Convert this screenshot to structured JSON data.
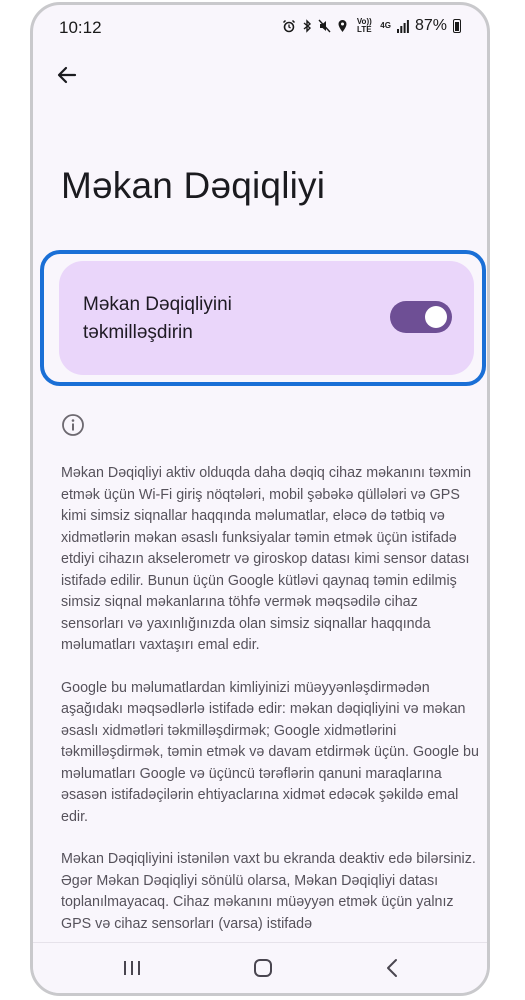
{
  "status_bar": {
    "time": "10:12",
    "network_label": "4G",
    "volte_label": "Vo)) LTE",
    "battery": "87%",
    "icons": [
      "alarm-icon",
      "bluetooth-icon",
      "mute-icon",
      "location-icon",
      "volte-icon",
      "4g-icon",
      "signal-icon",
      "battery-icon"
    ]
  },
  "header": {
    "back_icon": "arrow-left-icon",
    "title": "Məkan Dəqiqliyi"
  },
  "toggle": {
    "label": "Məkan Dəqiqliyini təkmilləşdirin",
    "state": "on",
    "color_on": "#6e4f95",
    "card_color": "#ead6fa"
  },
  "highlight_color": "#1a6fd6",
  "info": {
    "icon": "info-icon",
    "paragraphs": [
      "Məkan Dəqiqliyi aktiv olduqda daha dəqiq cihaz məkanını təxmin etmək üçün Wi-Fi giriş nöqtələri, mobil şəbəkə qüllələri və GPS kimi simsiz siqnallar haqqında məlumatlar, eləcə də tətbiq və xidmətlərin məkan əsaslı funksiyalar təmin etmək üçün istifadə etdiyi cihazın akselerometr və giroskop datası kimi sensor datası istifadə edilir. Bunun üçün Google kütləvi qaynaq təmin edilmiş simsiz siqnal məkanlarına töhfə vermək məqsədilə cihaz sensorları və yaxınlığınızda olan simsiz siqnallar haqqında məlumatları vaxtaşırı emal edir.",
      "Google bu məlumatlardan kimliyinizi müəyyənləşdirmədən aşağıdakı məqsədlərlə istifadə edir: məkan dəqiqliyini və məkan əsaslı xidmətləri təkmilləşdirmək; Google xidmətlərini təkmilləşdirmək, təmin etmək və davam etdirmək üçün. Google bu məlumatları Google və üçüncü tərəflərin qanuni maraqlarına əsasən istifadəçilərin ehtiyaclarına xidmət edəcək şəkildə emal edir.",
      "Məkan Dəqiqliyini istənilən vaxt bu ekranda deaktiv edə bilərsiniz. Əgər Məkan Dəqiqliyi sönülü olarsa, Məkan Dəqiqliyi datası toplanılmayacaq. Cihaz məkanını müəyyən etmək üçün yalnız GPS və cihaz sensorları (varsa) istifadə"
    ]
  },
  "nav_bar": {
    "recents_icon": "recents-icon",
    "home_icon": "home-icon",
    "back_icon": "back-chevron-icon"
  }
}
